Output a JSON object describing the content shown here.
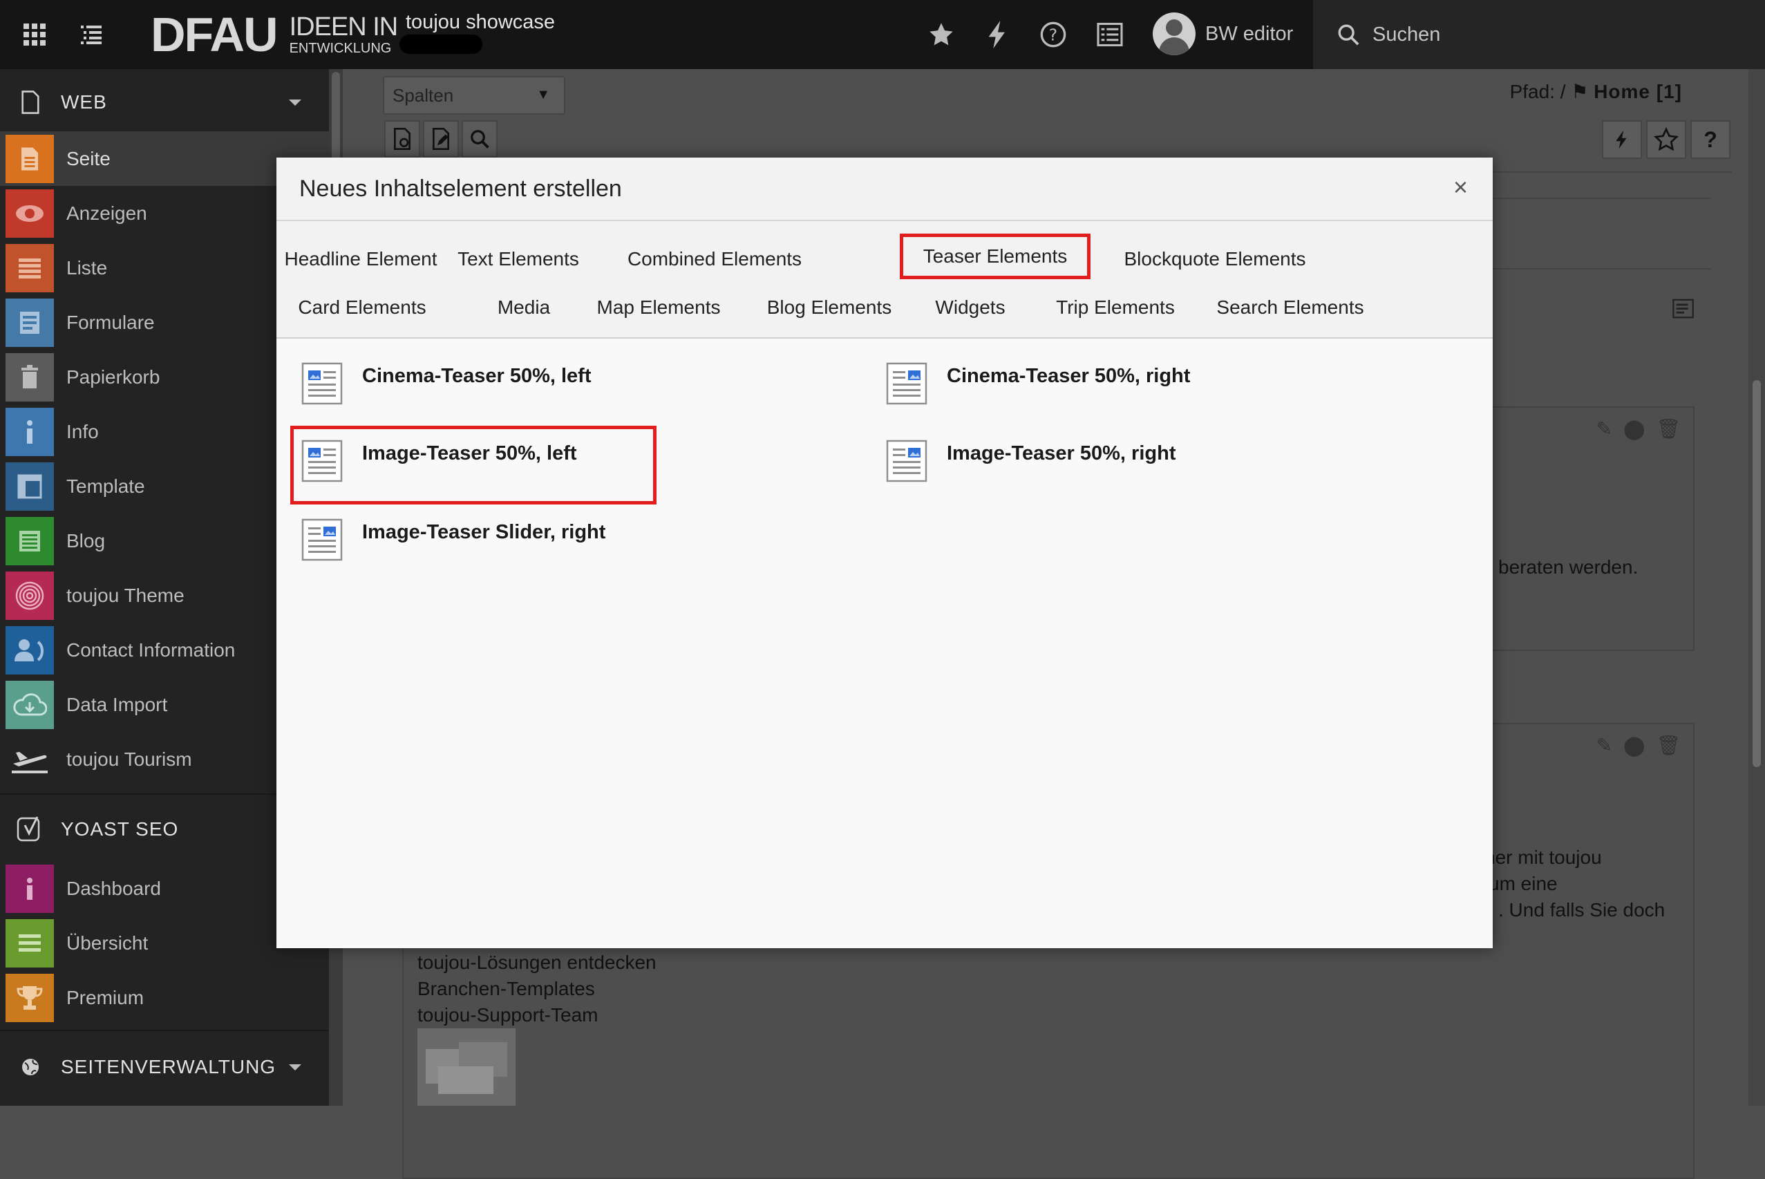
{
  "topbar": {
    "logo_big": "DFAU",
    "logo_small_1": "IDEEN IN",
    "logo_small_2": "ENTWICKLUNG",
    "site_title": "toujou showcase",
    "user_name": "BW editor",
    "search_label": "Suchen"
  },
  "sidebar": {
    "sections": [
      {
        "label": "WEB"
      },
      {
        "label": "YOAST SEO"
      },
      {
        "label": "SEITENVERWALTUNG"
      }
    ],
    "web_items": [
      {
        "label": "Seite",
        "color": "#d9721e",
        "icon": "page-icon"
      },
      {
        "label": "Anzeigen",
        "color": "#c0392b",
        "icon": "eye-icon"
      },
      {
        "label": "Liste",
        "color": "#c0532b",
        "icon": "list-icon"
      },
      {
        "label": "Formulare",
        "color": "#4479a8",
        "icon": "form-icon"
      },
      {
        "label": "Papierkorb",
        "color": "#5b5b5b",
        "icon": "trash-icon"
      },
      {
        "label": "Info",
        "color": "#3d77ad",
        "icon": "info-icon"
      },
      {
        "label": "Template",
        "color": "#2b5d88",
        "icon": "template-icon"
      },
      {
        "label": "Blog",
        "color": "#2e8a2e",
        "icon": "blog-icon"
      },
      {
        "label": "toujou Theme",
        "color": "#b52a55",
        "icon": "fingerprint-icon"
      },
      {
        "label": "Contact Information",
        "color": "#1f5f9a",
        "icon": "contact-icon"
      },
      {
        "label": "Data Import",
        "color": "#5a9e8c",
        "icon": "cloud-icon"
      },
      {
        "label": "toujou Tourism",
        "color": "#232323",
        "icon": "plane-icon"
      }
    ],
    "yoast_items": [
      {
        "label": "Dashboard",
        "color": "#8e1e63",
        "icon": "info-icon"
      },
      {
        "label": "Übersicht",
        "color": "#6a9b2e",
        "icon": "overview-icon"
      },
      {
        "label": "Premium",
        "color": "#c9791e",
        "icon": "trophy-icon"
      }
    ]
  },
  "main": {
    "column_select": "Spalten",
    "path_label": "Pfad: /",
    "path_page": "Home [1]",
    "bg_text": {
      "line_a": "beraten werden.",
      "line_b1": "ner mit toujou",
      "line_b2": "um eine",
      "line_b3": ". Und falls Sie doch",
      "link1": "toujou-Lösungen entdecken",
      "link2": "Branchen-Templates",
      "link3": "toujou-Support-Team"
    }
  },
  "modal": {
    "title": "Neues Inhaltselement erstellen",
    "close": "×",
    "tabs_row1": [
      "Headline Element",
      "Text Elements",
      "Combined Elements",
      "Teaser Elements",
      "Blockquote Elements"
    ],
    "tabs_row2": [
      "Card Elements",
      "Media",
      "Map Elements",
      "Blog Elements",
      "Widgets",
      "Trip Elements",
      "Search Elements"
    ],
    "active_tab": "Teaser Elements",
    "elements": [
      {
        "label": "Cinema-Teaser 50%, left",
        "icon": "teaser-left-icon"
      },
      {
        "label": "Cinema-Teaser 50%, right",
        "icon": "teaser-right-icon"
      },
      {
        "label": "Image-Teaser 50%, left",
        "icon": "teaser-left-icon"
      },
      {
        "label": "Image-Teaser 50%, right",
        "icon": "teaser-right-icon"
      },
      {
        "label": "Image-Teaser Slider, right",
        "icon": "teaser-slider-icon"
      }
    ]
  }
}
